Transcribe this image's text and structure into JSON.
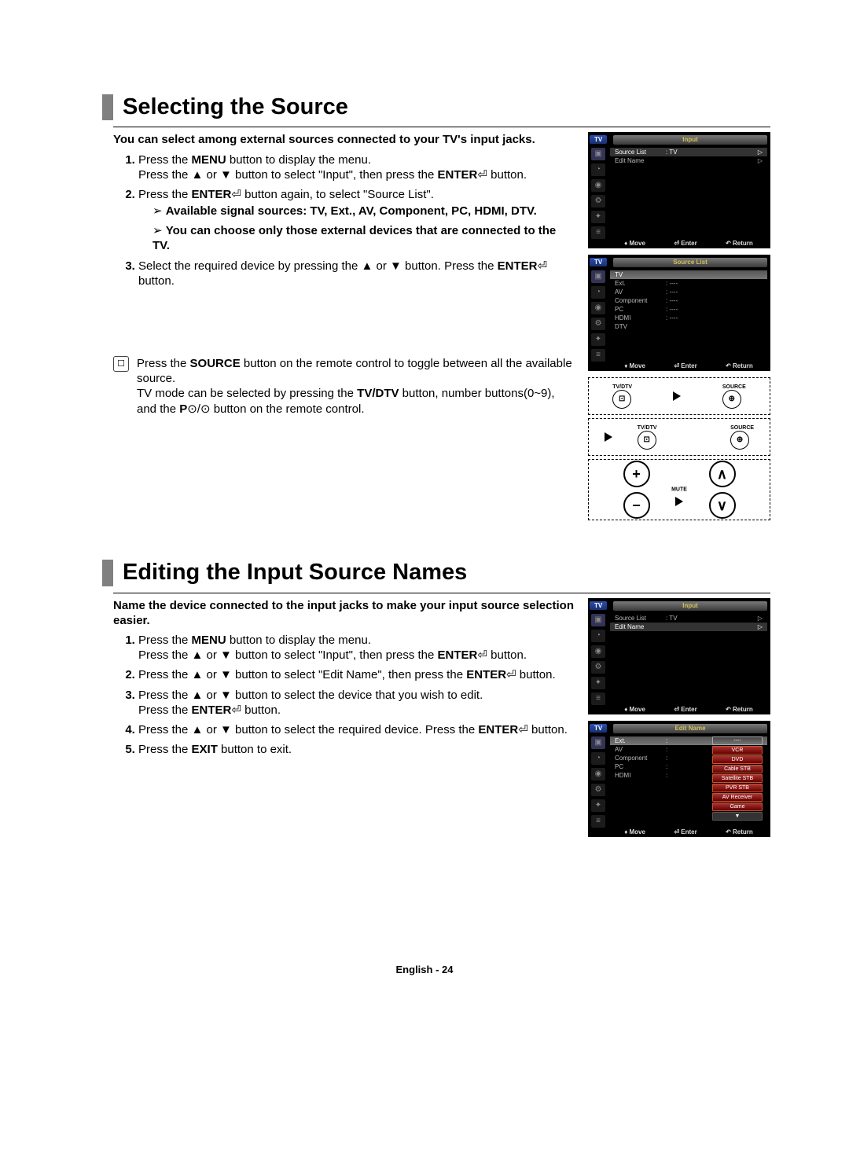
{
  "section1": {
    "title": "Selecting the Source",
    "intro": "You can select among external sources connected to your TV's input jacks.",
    "step1_a": "Press the ",
    "step1_menu": "MENU",
    "step1_b": " button to display the menu.",
    "step1_c": "Press the ▲ or ▼ button to select \"Input\", then press the ",
    "step1_enter": "ENTER",
    "step1_d": " button.",
    "step2_a": "Press the ",
    "step2_enter": "ENTER",
    "step2_b": " button again, to select \"Source List\".",
    "step2_li1": "Available signal sources: TV, Ext., AV, Component, PC, HDMI, DTV.",
    "step2_li2": "You can choose only those external devices that are connected to the TV.",
    "step3_a": "Select the required device by pressing the ▲ or ▼ button. Press the ",
    "step3_enter": "ENTER",
    "step3_b": " button.",
    "note_a": "Press the ",
    "note_source": "SOURCE",
    "note_b": " button on the remote control to toggle between all the available source.",
    "note_c": "TV mode can be selected by pressing the ",
    "note_tvdtv": "TV/DTV",
    "note_d": " button, number buttons(0~9), and the ",
    "note_p": "P",
    "note_e": "⊙/⊙ button on the remote control."
  },
  "section2": {
    "title": "Editing the Input Source Names",
    "intro": "Name the device connected to the input jacks to make your input source selection easier.",
    "s1_a": "Press the ",
    "s1_menu": "MENU",
    "s1_b": " button to display the menu.",
    "s1_c": "Press the ▲ or ▼ button to select \"Input\", then press the ",
    "s1_enter": "ENTER",
    "s1_d": " button.",
    "s2_a": "Press the ▲ or ▼ button to select \"Edit Name\", then press the ",
    "s2_enter": "ENTER",
    "s2_b": " button.",
    "s3_a": "Press the ▲ or ▼ button to select the device that you wish to edit.",
    "s3_b": "Press the ",
    "s3_enter": "ENTER",
    "s3_c": " button.",
    "s4_a": "Press the ▲ or ▼ button to select the required device. Press the ",
    "s4_enter": "ENTER",
    "s4_b": " button.",
    "s5_a": "Press the ",
    "s5_exit": "EXIT",
    "s5_b": " button to exit."
  },
  "osd": {
    "tv": "TV",
    "input_title": "Input",
    "source_list_title": "Source List",
    "edit_name_title": "Edit Name",
    "source_list_label": "Source List",
    "edit_name_label": "Edit Name",
    "value_tv": ": TV",
    "arrow": "▷",
    "sources": [
      "TV",
      "Ext.",
      "AV",
      "Component",
      "PC",
      "HDMI",
      "DTV"
    ],
    "dots": ": ----",
    "edit_sources": [
      "Ext.",
      "AV",
      "Component",
      "PC",
      "HDMI"
    ],
    "device_opts": [
      "----",
      "VCR",
      "DVD",
      "Cable STB",
      "Satellite STB",
      "PVR STB",
      "AV Receiver",
      "Game",
      "▼"
    ],
    "move": "Move",
    "enter": "Enter",
    "return": "Return",
    "move_sym": "♦",
    "enter_sym": "⏎",
    "return_sym": "↶"
  },
  "remote": {
    "tvdtv": "TV/DTV",
    "source": "SOURCE",
    "mute": "MUTE",
    "plus": "+",
    "minus": "−",
    "up": "∧",
    "down": "∨"
  },
  "footer": "English - 24"
}
